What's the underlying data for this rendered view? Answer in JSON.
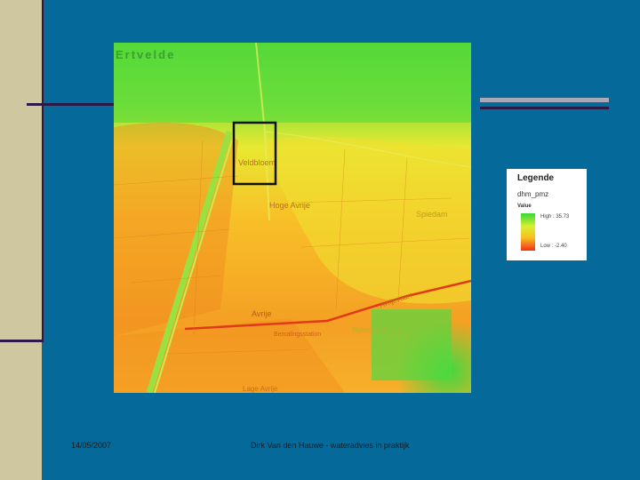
{
  "map": {
    "place_labels": {
      "ertvelde": "Ertvelde",
      "veldbloem": "Veldbloem",
      "hoge_avrije": "Hoge Avrije",
      "spiedam": "Spiedam",
      "avrije": "Avrije",
      "spiedambrug": "Spiedambrug",
      "bombing_station": "Bemalingsstation",
      "avrijevaart": "Avrijevaart",
      "lage_avrije": "Lage Avrije"
    },
    "colors": {
      "high": "#35d835",
      "mid": "#d8f030",
      "midlow": "#f8c020",
      "low": "#f03018"
    }
  },
  "legend": {
    "title": "Legende",
    "layer": "dhm_pmz",
    "field": "Value",
    "high": "High : 35.73",
    "low": "Low : -2.40"
  },
  "footer": {
    "date": "14/05/2007",
    "text": "Dirk Van den Hauwe - wateradvies in praktijk"
  }
}
